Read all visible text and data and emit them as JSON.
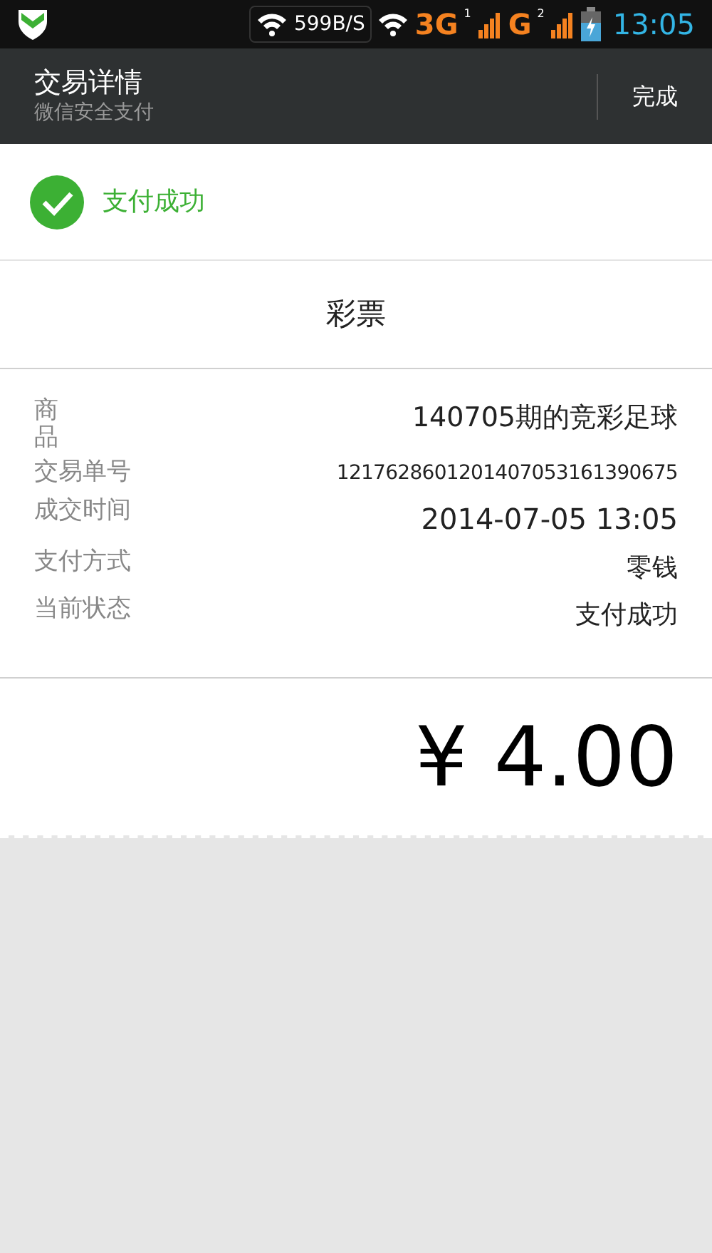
{
  "status_bar": {
    "speed": "599B/S",
    "network_1": "3G",
    "sim_1": "1",
    "network_2": "G",
    "sim_2": "2",
    "time": "13:05"
  },
  "header": {
    "title": "交易详情",
    "subtitle": "微信安全支付",
    "done_button": "完成"
  },
  "result": {
    "text": "支付成功"
  },
  "merchant": "彩票",
  "details": [
    {
      "label": "商品",
      "value": "140705期的竞彩足球",
      "kind": "wrap"
    },
    {
      "label": "交易单号",
      "value": "1217628601201407053161390675",
      "kind": "small"
    },
    {
      "label": "成交时间",
      "value": "2014-07-05 13:05",
      "kind": "large"
    },
    {
      "label": "支付方式",
      "value": "零钱",
      "kind": "normal"
    },
    {
      "label": "当前状态",
      "value": "支付成功",
      "kind": "normal"
    }
  ],
  "amount": "¥ 4.00"
}
